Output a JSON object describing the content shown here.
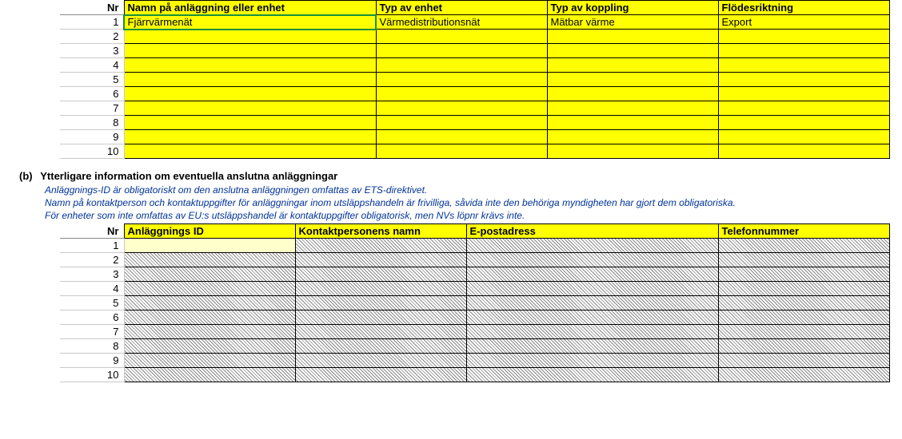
{
  "table1": {
    "headers": {
      "nr": "Nr",
      "namn": "Namn på anläggning eller enhet",
      "typ_enhet": "Typ av enhet",
      "typ_koppling": "Typ av koppling",
      "flodesriktning": "Flödesriktning"
    },
    "rows": [
      {
        "nr": "1",
        "namn": "Fjärrvärmenät",
        "typ_enhet": "Värmedistributionsnät",
        "typ_koppling": "Mätbar värme",
        "flodesriktning": "Export"
      },
      {
        "nr": "2",
        "namn": "",
        "typ_enhet": "",
        "typ_koppling": "",
        "flodesriktning": ""
      },
      {
        "nr": "3",
        "namn": "",
        "typ_enhet": "",
        "typ_koppling": "",
        "flodesriktning": ""
      },
      {
        "nr": "4",
        "namn": "",
        "typ_enhet": "",
        "typ_koppling": "",
        "flodesriktning": ""
      },
      {
        "nr": "5",
        "namn": "",
        "typ_enhet": "",
        "typ_koppling": "",
        "flodesriktning": ""
      },
      {
        "nr": "6",
        "namn": "",
        "typ_enhet": "",
        "typ_koppling": "",
        "flodesriktning": ""
      },
      {
        "nr": "7",
        "namn": "",
        "typ_enhet": "",
        "typ_koppling": "",
        "flodesriktning": ""
      },
      {
        "nr": "8",
        "namn": "",
        "typ_enhet": "",
        "typ_koppling": "",
        "flodesriktning": ""
      },
      {
        "nr": "9",
        "namn": "",
        "typ_enhet": "",
        "typ_koppling": "",
        "flodesriktning": ""
      },
      {
        "nr": "10",
        "namn": "",
        "typ_enhet": "",
        "typ_koppling": "",
        "flodesriktning": ""
      }
    ]
  },
  "section_b": {
    "label": "(b)",
    "title": "Ytterligare information om eventuella anslutna anläggningar",
    "help": [
      "Anläggnings-ID är obligatoriskt om den anslutna anläggningen omfattas av ETS-direktivet.",
      "Namn på kontaktperson och kontaktuppgifter för anläggningar inom utsläppshandeln är frivilliga, såvida inte den behöriga myndigheten har gjort dem obligatoriska.",
      "För enheter som inte omfattas av EU:s utsläppshandel är kontaktuppgifter obligatorisk, men NVs löpnr krävs inte."
    ]
  },
  "table2": {
    "headers": {
      "nr": "Nr",
      "anlaggnings_id": "Anläggnings ID",
      "kontaktperson": "Kontaktpersonens namn",
      "epost": "E-postadress",
      "telefon": "Telefonnummer"
    },
    "rows": [
      {
        "nr": "1"
      },
      {
        "nr": "2"
      },
      {
        "nr": "3"
      },
      {
        "nr": "4"
      },
      {
        "nr": "5"
      },
      {
        "nr": "6"
      },
      {
        "nr": "7"
      },
      {
        "nr": "8"
      },
      {
        "nr": "9"
      },
      {
        "nr": "10"
      }
    ]
  }
}
